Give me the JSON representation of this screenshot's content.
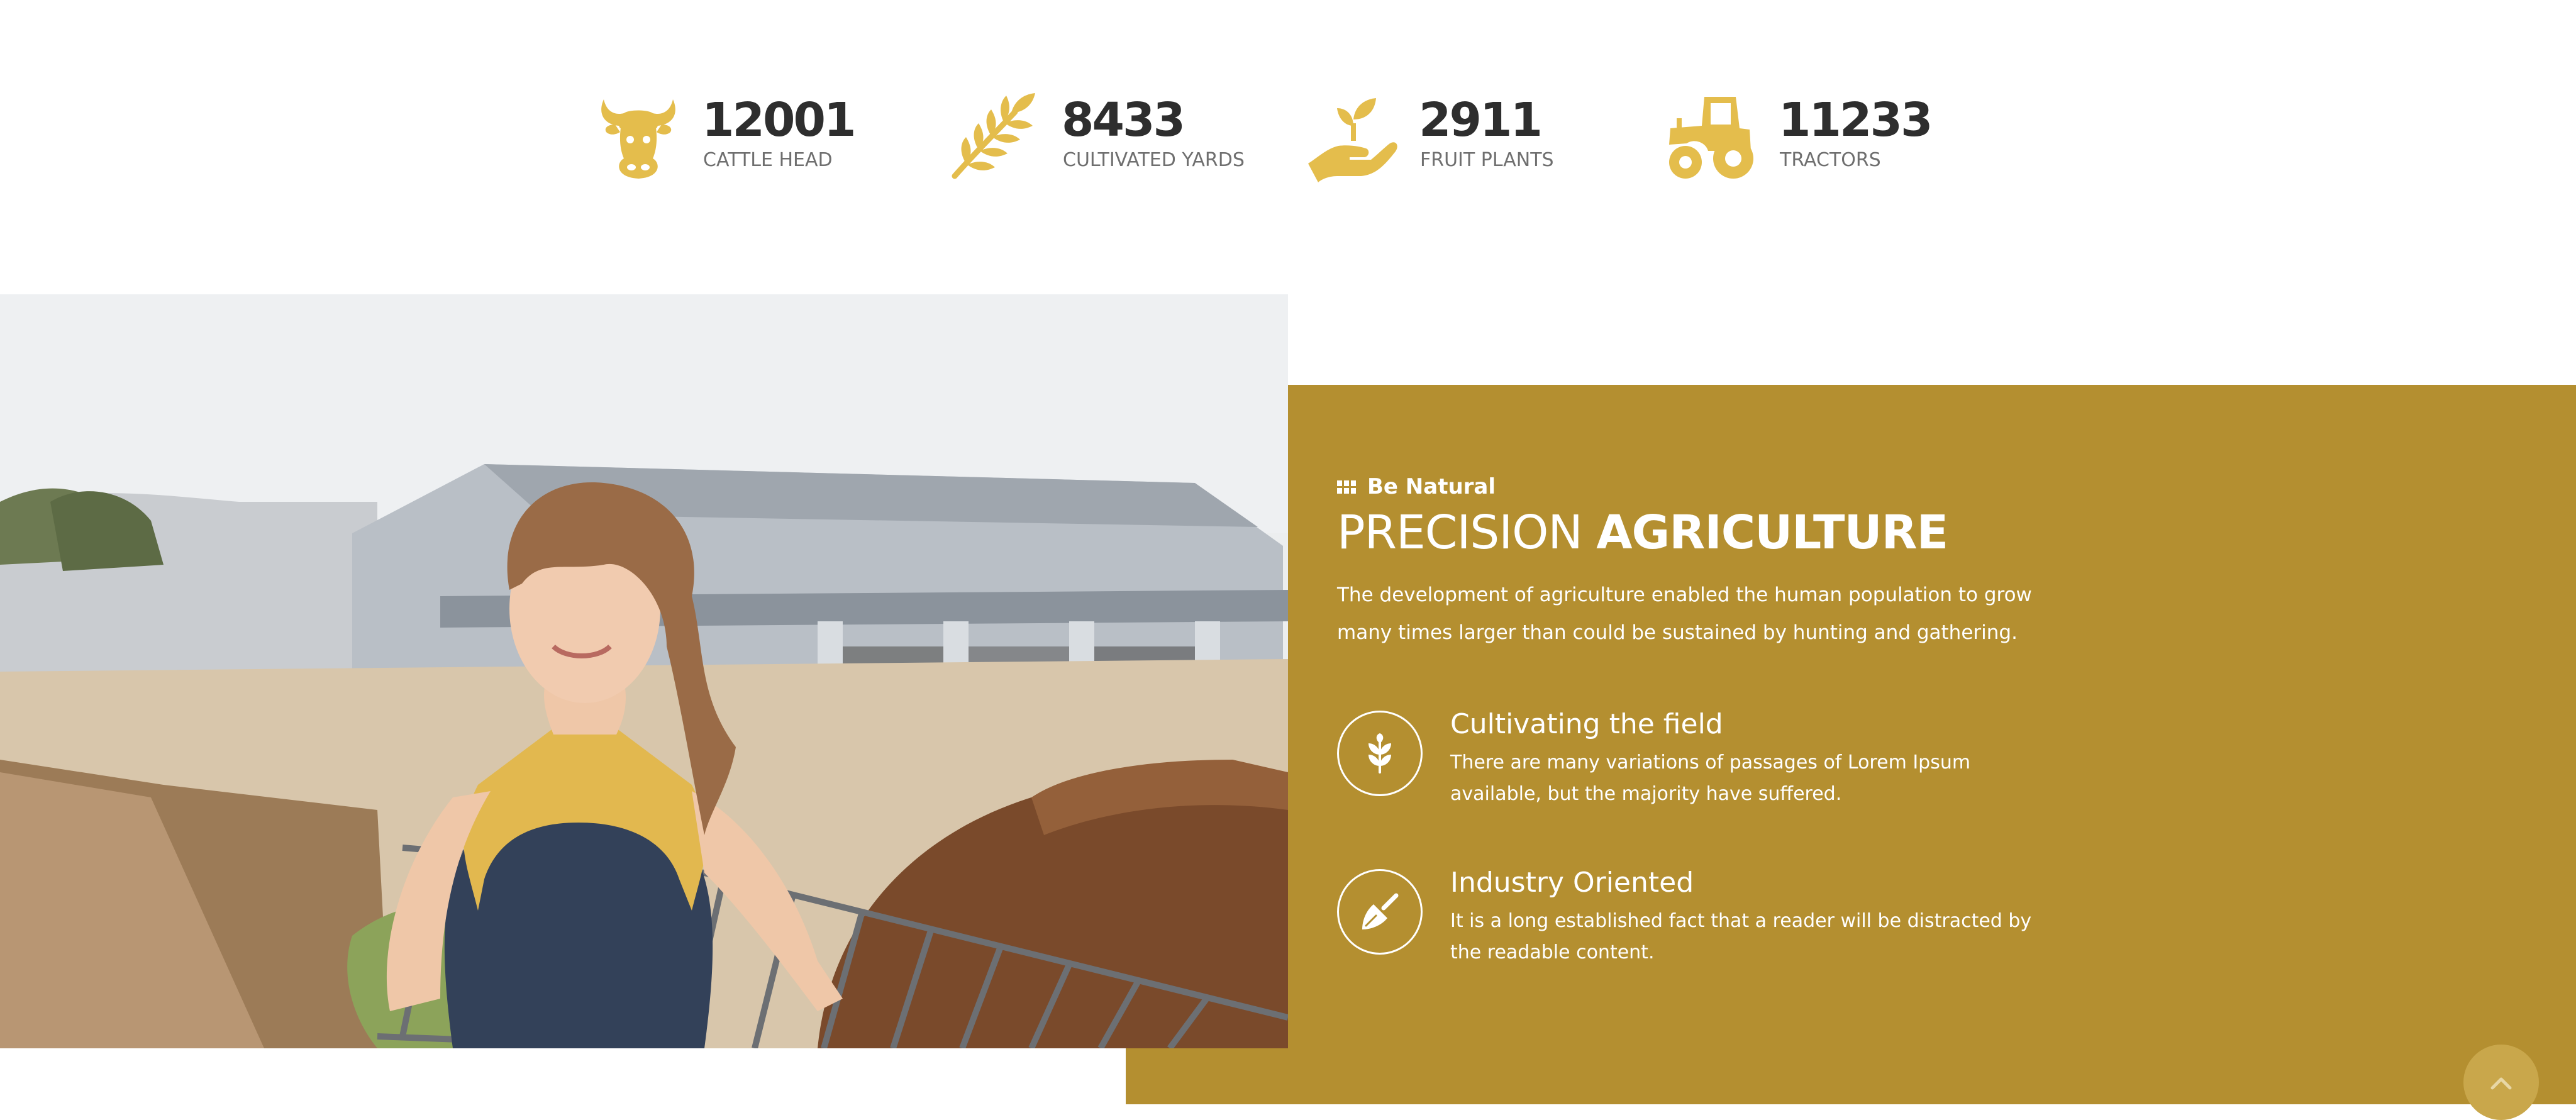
{
  "stats": [
    {
      "icon": "cow-head-icon",
      "value": "12001",
      "label": "CATTLE HEAD"
    },
    {
      "icon": "wheat-icon",
      "value": "8433",
      "label": "CULTIVATED YARDS"
    },
    {
      "icon": "plant-in-hand-icon",
      "value": "2911",
      "label": "FRUIT PLANTS"
    },
    {
      "icon": "tractor-icon",
      "value": "11233",
      "label": "TRACTORS"
    }
  ],
  "about": {
    "eyebrow": "Be Natural",
    "heading_light": "PRECISION",
    "heading_bold": "AGRICULTURE",
    "intro": "The development of agriculture enabled the human population to grow many times larger than could be sustained by hunting and gathering.",
    "features": [
      {
        "icon": "wheat-leaf-icon",
        "title": "Cultivating the field",
        "text": "There are many variations of passages of Lorem Ipsum available, but the majority have suffered."
      },
      {
        "icon": "garden-trowel-icon",
        "title": "Industry Oriented",
        "text": "It is a long established fact that a reader will be distracted by the readable content."
      }
    ]
  },
  "colors": {
    "accent": "#e4bd4c",
    "panel": "#b48f30",
    "text_dark": "#2e2e2e",
    "text_muted": "#6f6f6f"
  },
  "scroll_top_icon": "chevron-up-icon"
}
